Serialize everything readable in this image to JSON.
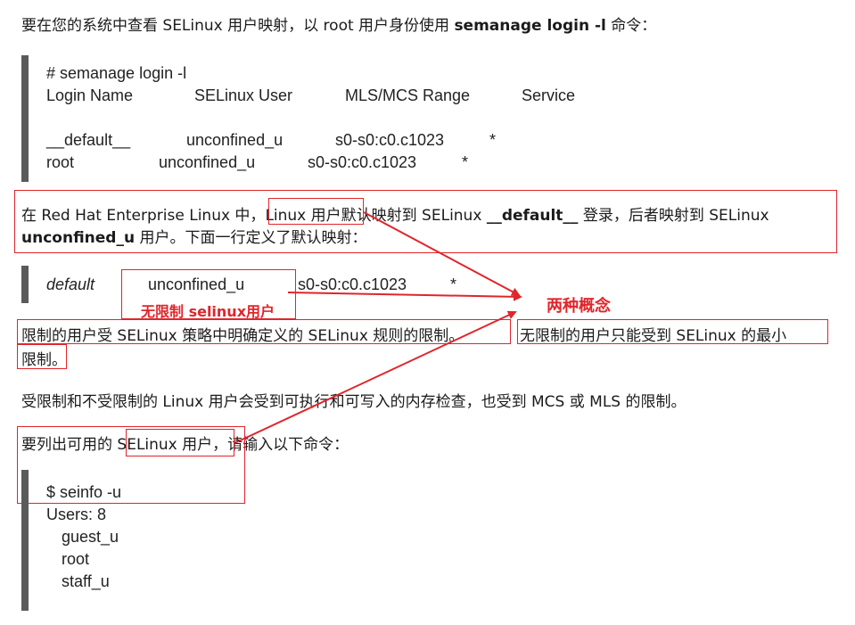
{
  "intro": {
    "text_before": "要在您的系统中查看 SELinux 用户映射，以 root 用户身份使用 ",
    "command": "semanage login -l",
    "text_after": " 命令："
  },
  "code_block_1": {
    "command": "# semanage login -l",
    "headers": [
      "Login Name",
      "SELinux User",
      "MLS/MCS Range",
      "Service"
    ],
    "rows": [
      [
        "__default__",
        "unconfined_u",
        "s0-s0:c0.c1023",
        "*"
      ],
      [
        "root",
        "unconfined_u",
        "s0-s0:c0.c1023",
        "*"
      ]
    ]
  },
  "para_default": {
    "prefix": "在 Red Hat Enterprise Linux 中，",
    "linux_user": "Linux 用户",
    "middle": "默认映射到 SELinux ",
    "default_login": "__default__",
    "suffix": " 登录，后者映射到 SELinux",
    "line2_bold": "unconfined_u",
    "line2_rest": " 用户。下面一行定义了默认映射："
  },
  "code_block_2": {
    "login": "default",
    "selinux_user": "unconfined_u",
    "range": "s0-s0:c0.c1023",
    "service": "*"
  },
  "annotations": {
    "unconfined_note": "无限制 selinux用户",
    "two_concepts": "两种概念"
  },
  "para_confined": {
    "confined_sentence": "限制的用户受 SELinux 策略中明确定义的 SELinux 规则的限制。",
    "unconfined_line1": "无限制的用户只能受到 SELinux 的最小",
    "unconfined_line2": "限制。"
  },
  "para_memory": "受限制和不受限制的 Linux 用户会受到可执行和可写入的内存检查，也受到 MCS 或 MLS 的限制。",
  "para_list": {
    "prefix": "要列出可用的 ",
    "selinux_user": "SELinux 用户",
    "suffix": "，请输入以下命令："
  },
  "code_block_3": {
    "command": "$ seinfo -u",
    "count_line": "Users: 8",
    "users": [
      "guest_u",
      "root",
      "staff_u"
    ]
  },
  "colors": {
    "annotation_red": "#e0252b",
    "code_bar": "#5a5a5a"
  }
}
